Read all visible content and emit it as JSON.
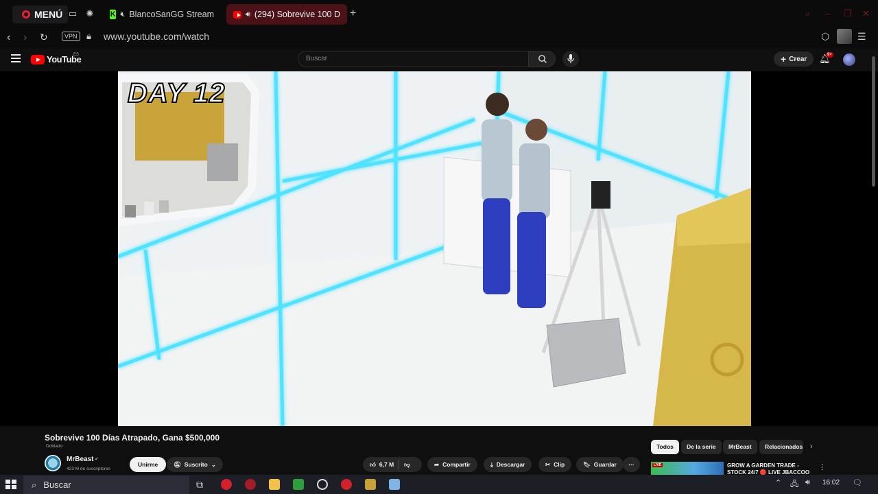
{
  "browser": {
    "menu_label": "MENÚ",
    "tabs": [
      {
        "label": "BlancoSanGG Stream"
      },
      {
        "label": "(294) Sobrevive 100 D"
      }
    ],
    "new_tab": "+",
    "vpn": "VPN",
    "url": "www.youtube.com/watch"
  },
  "youtube": {
    "logo_text": "YouTube",
    "region": "ES",
    "search_placeholder": "Buscar",
    "create_label": "Crear",
    "notifications": "9+"
  },
  "video": {
    "overlay_text": "DAY 12",
    "title": "Sobrevive 100 Días Atrapado, Gana $500,000",
    "dub_tag": "Doblado",
    "channel": "MrBeast",
    "subscribers": "423 M de suscriptores",
    "join_label": "Unirme",
    "subscribed_label": "Suscrito",
    "likes": "6,7 M",
    "share_label": "Compartir",
    "download_label": "Descargar",
    "clip_label": "Clip",
    "save_label": "Guardar"
  },
  "chips": [
    "Todos",
    "De la serie",
    "MrBeast",
    "Relacionados"
  ],
  "recommendation": {
    "live_badge": "LIVE",
    "title": "GROW A GARDEN TRADE - STOCK 24/7 🔴 LIVE JBACCOO"
  },
  "taskbar": {
    "search_label": "Buscar",
    "time": "16:02"
  },
  "colors": {
    "accent_red": "#ff0000",
    "opera_red": "#e51f2f",
    "background": "#0f0f0f"
  }
}
